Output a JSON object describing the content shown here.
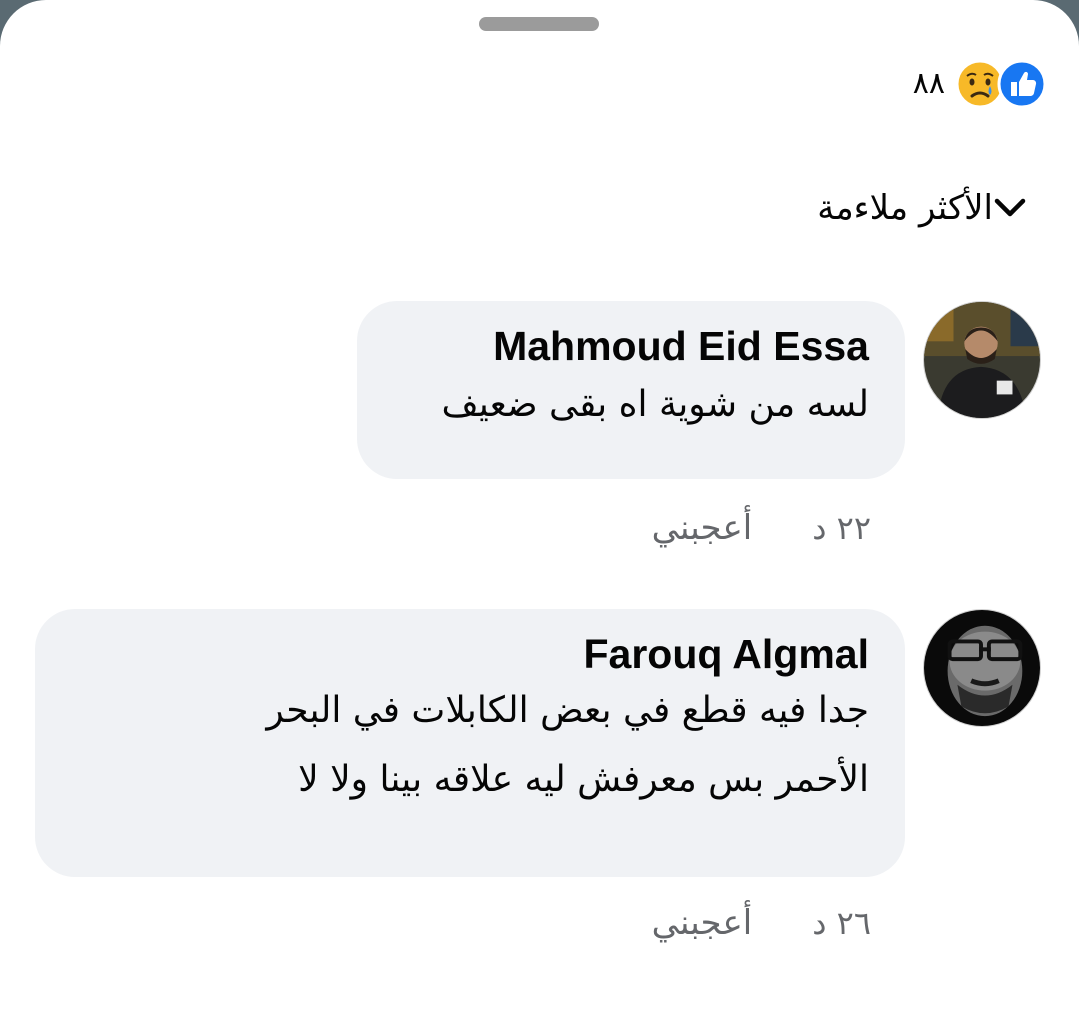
{
  "reactions": {
    "icons": [
      "like-icon",
      "sad-icon"
    ],
    "count": "٨٨",
    "colors": {
      "like": "#1877f2",
      "sad": "#f7b928"
    }
  },
  "sort": {
    "label": "الأكثر ملاءمة",
    "icon": "chevron-down-icon"
  },
  "comments": [
    {
      "author": "Mahmoud Eid Essa",
      "lines": [
        "لسه من شوية اه بقى ضعيف"
      ],
      "time": "٢٢ د",
      "like_label": "أعجبني"
    },
    {
      "author": "Farouq Algmal",
      "lines": [
        "جدا فيه قطع في بعض الكابلات في البحر",
        "الأحمر بس معرفش ليه علاقه بينا ولا لا"
      ],
      "time": "٢٦ د",
      "like_label": "أعجبني"
    }
  ]
}
